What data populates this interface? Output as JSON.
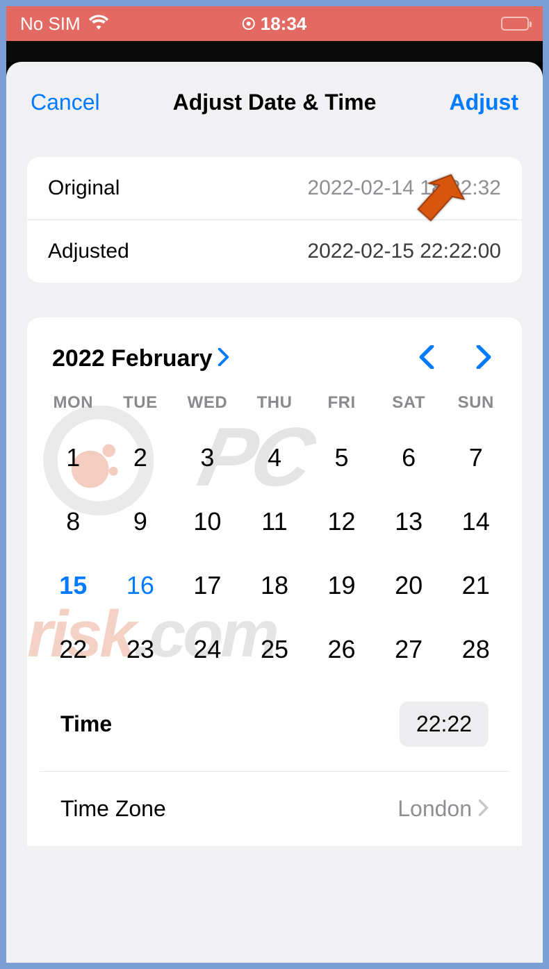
{
  "statusBar": {
    "carrier": "No SIM",
    "time": "18:34"
  },
  "header": {
    "cancel": "Cancel",
    "title": "Adjust Date & Time",
    "adjust": "Adjust"
  },
  "info": {
    "originalLabel": "Original",
    "originalValue": "2022-02-14 18:22:32",
    "adjustedLabel": "Adjusted",
    "adjustedValue": "2022-02-15 22:22:00"
  },
  "calendar": {
    "monthYear": "2022 February",
    "weekdays": [
      "MON",
      "TUE",
      "WED",
      "THU",
      "FRI",
      "SAT",
      "SUN"
    ],
    "leadingBlanks": 0,
    "daysInMonth": 28,
    "selectedDay": 15,
    "todayDay": 16
  },
  "time": {
    "label": "Time",
    "value": "22:22"
  },
  "timezone": {
    "label": "Time Zone",
    "value": "London"
  }
}
